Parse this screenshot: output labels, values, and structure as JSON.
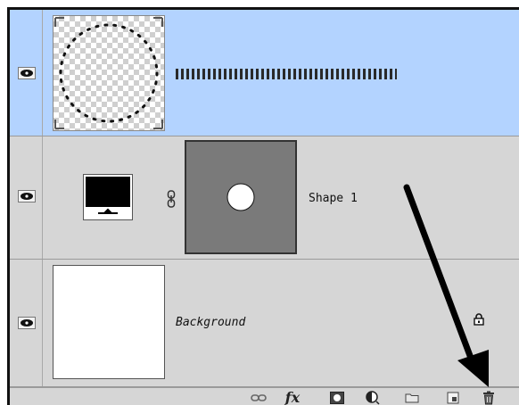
{
  "layers": [
    {
      "name": "",
      "selected": true,
      "visible": true
    },
    {
      "name": "Shape 1",
      "selected": false,
      "visible": true
    },
    {
      "name": "Background",
      "selected": false,
      "visible": true,
      "locked": true
    }
  ],
  "colors": {
    "selected_row": "#b3d3ff",
    "panel_bg": "#d6d6d6",
    "mask_bg": "#7a7a7a"
  },
  "bottom_toolbar": {
    "icons": [
      "link-layers-icon",
      "fx-layer-style-icon",
      "add-layer-mask-icon",
      "adjustment-layer-icon",
      "new-group-folder-icon",
      "new-layer-icon",
      "delete-layer-trash-icon"
    ],
    "fx_label": "fx"
  }
}
